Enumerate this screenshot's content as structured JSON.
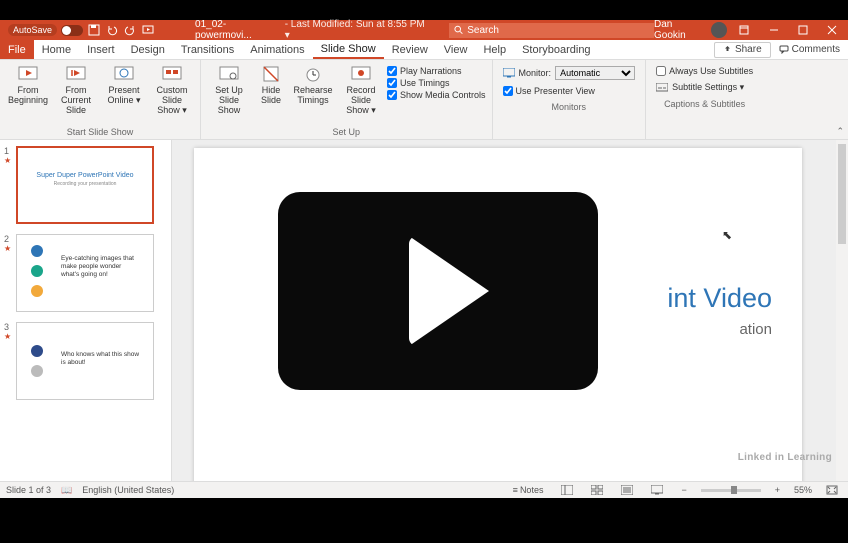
{
  "titlebar": {
    "autosave": "AutoSave",
    "filename": "01_02-powermovi...",
    "modified": "- Last Modified: Sun at 8:55 PM ▾",
    "search_placeholder": "Search",
    "user": "Dan Gookin"
  },
  "tabs": {
    "file": "File",
    "items": [
      "Home",
      "Insert",
      "Design",
      "Transitions",
      "Animations",
      "Slide Show",
      "Review",
      "View",
      "Help",
      "Storyboarding"
    ],
    "active": "Slide Show",
    "share": "Share",
    "comments": "Comments"
  },
  "ribbon": {
    "start": {
      "label": "Start Slide Show",
      "from_beginning": "From Beginning",
      "from_current": "From Current Slide",
      "present_online": "Present Online ▾",
      "custom": "Custom Slide Show ▾"
    },
    "setup": {
      "label": "Set Up",
      "setup_show": "Set Up Slide Show",
      "hide": "Hide Slide",
      "rehearse": "Rehearse Timings",
      "record": "Record Slide Show ▾",
      "play_narr": "Play Narrations",
      "use_timings": "Use Timings",
      "show_media": "Show Media Controls"
    },
    "monitors": {
      "label": "Monitors",
      "monitor": "Monitor:",
      "monitor_value": "Automatic",
      "presenter": "Use Presenter View"
    },
    "captions": {
      "label": "Captions & Subtitles",
      "always": "Always Use Subtitles",
      "settings": "Subtitle Settings ▾"
    }
  },
  "thumbs": [
    {
      "n": "1",
      "title": "Super Duper PowerPoint Video",
      "sub": "Recording your presentation"
    },
    {
      "n": "2",
      "text": "Eye-catching images that make people wonder what's going on!"
    },
    {
      "n": "3",
      "text": "Who knows what this show is about!"
    }
  ],
  "slide": {
    "title_fragment": "int Video",
    "sub_fragment": "ation"
  },
  "status": {
    "slide": "Slide 1 of 3",
    "lang": "English (United States)",
    "notes": "Notes",
    "zoom": "55%"
  },
  "watermark": "Linked in Learning"
}
